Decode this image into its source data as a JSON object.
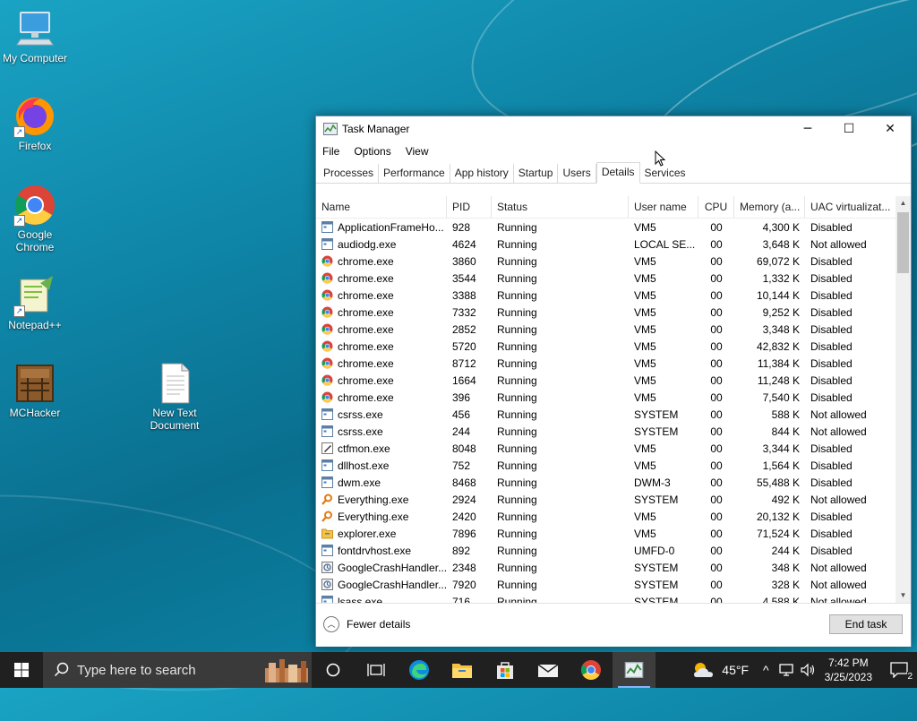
{
  "desktop": {
    "icons": [
      {
        "label": "My Computer"
      },
      {
        "label": "Firefox"
      },
      {
        "label": "Google Chrome"
      },
      {
        "label": "Notepad++"
      },
      {
        "label": "MCHacker"
      },
      {
        "label": "New Text Document"
      }
    ]
  },
  "window": {
    "title": "Task Manager",
    "controls": {
      "minimize": "─",
      "maximize": "☐",
      "close": "✕"
    },
    "menu": [
      "File",
      "Options",
      "View"
    ],
    "tabs": [
      "Processes",
      "Performance",
      "App history",
      "Startup",
      "Users",
      "Details",
      "Services"
    ],
    "active_tab": "Details",
    "columns": [
      "Name",
      "PID",
      "Status",
      "User name",
      "CPU",
      "Memory (a...",
      "UAC virtualizat..."
    ],
    "rows": [
      {
        "icon": "app-window-icon",
        "name": "ApplicationFrameHo...",
        "pid": "928",
        "status": "Running",
        "user": "VM5",
        "cpu": "00",
        "mem": "4,300 K",
        "uac": "Disabled"
      },
      {
        "icon": "app-window-icon",
        "name": "audiodg.exe",
        "pid": "4624",
        "status": "Running",
        "user": "LOCAL SE...",
        "cpu": "00",
        "mem": "3,648 K",
        "uac": "Not allowed"
      },
      {
        "icon": "chrome-icon",
        "name": "chrome.exe",
        "pid": "3860",
        "status": "Running",
        "user": "VM5",
        "cpu": "00",
        "mem": "69,072 K",
        "uac": "Disabled"
      },
      {
        "icon": "chrome-icon",
        "name": "chrome.exe",
        "pid": "3544",
        "status": "Running",
        "user": "VM5",
        "cpu": "00",
        "mem": "1,332 K",
        "uac": "Disabled"
      },
      {
        "icon": "chrome-icon",
        "name": "chrome.exe",
        "pid": "3388",
        "status": "Running",
        "user": "VM5",
        "cpu": "00",
        "mem": "10,144 K",
        "uac": "Disabled"
      },
      {
        "icon": "chrome-icon",
        "name": "chrome.exe",
        "pid": "7332",
        "status": "Running",
        "user": "VM5",
        "cpu": "00",
        "mem": "9,252 K",
        "uac": "Disabled"
      },
      {
        "icon": "chrome-icon",
        "name": "chrome.exe",
        "pid": "2852",
        "status": "Running",
        "user": "VM5",
        "cpu": "00",
        "mem": "3,348 K",
        "uac": "Disabled"
      },
      {
        "icon": "chrome-icon",
        "name": "chrome.exe",
        "pid": "5720",
        "status": "Running",
        "user": "VM5",
        "cpu": "00",
        "mem": "42,832 K",
        "uac": "Disabled"
      },
      {
        "icon": "chrome-icon",
        "name": "chrome.exe",
        "pid": "8712",
        "status": "Running",
        "user": "VM5",
        "cpu": "00",
        "mem": "11,384 K",
        "uac": "Disabled"
      },
      {
        "icon": "chrome-icon",
        "name": "chrome.exe",
        "pid": "1664",
        "status": "Running",
        "user": "VM5",
        "cpu": "00",
        "mem": "11,248 K",
        "uac": "Disabled"
      },
      {
        "icon": "chrome-icon",
        "name": "chrome.exe",
        "pid": "396",
        "status": "Running",
        "user": "VM5",
        "cpu": "00",
        "mem": "7,540 K",
        "uac": "Disabled"
      },
      {
        "icon": "app-window-icon",
        "name": "csrss.exe",
        "pid": "456",
        "status": "Running",
        "user": "SYSTEM",
        "cpu": "00",
        "mem": "588 K",
        "uac": "Not allowed"
      },
      {
        "icon": "app-window-icon",
        "name": "csrss.exe",
        "pid": "244",
        "status": "Running",
        "user": "SYSTEM",
        "cpu": "00",
        "mem": "844 K",
        "uac": "Not allowed"
      },
      {
        "icon": "pen-icon",
        "name": "ctfmon.exe",
        "pid": "8048",
        "status": "Running",
        "user": "VM5",
        "cpu": "00",
        "mem": "3,344 K",
        "uac": "Disabled"
      },
      {
        "icon": "app-window-icon",
        "name": "dllhost.exe",
        "pid": "752",
        "status": "Running",
        "user": "VM5",
        "cpu": "00",
        "mem": "1,564 K",
        "uac": "Disabled"
      },
      {
        "icon": "app-window-icon",
        "name": "dwm.exe",
        "pid": "8468",
        "status": "Running",
        "user": "DWM-3",
        "cpu": "00",
        "mem": "55,488 K",
        "uac": "Disabled"
      },
      {
        "icon": "magnifier-icon",
        "name": "Everything.exe",
        "pid": "2924",
        "status": "Running",
        "user": "SYSTEM",
        "cpu": "00",
        "mem": "492 K",
        "uac": "Not allowed"
      },
      {
        "icon": "magnifier-icon",
        "name": "Everything.exe",
        "pid": "2420",
        "status": "Running",
        "user": "VM5",
        "cpu": "00",
        "mem": "20,132 K",
        "uac": "Disabled"
      },
      {
        "icon": "folder-icon",
        "name": "explorer.exe",
        "pid": "7896",
        "status": "Running",
        "user": "VM5",
        "cpu": "00",
        "mem": "71,524 K",
        "uac": "Disabled"
      },
      {
        "icon": "app-window-icon",
        "name": "fontdrvhost.exe",
        "pid": "892",
        "status": "Running",
        "user": "UMFD-0",
        "cpu": "00",
        "mem": "244 K",
        "uac": "Disabled"
      },
      {
        "icon": "crash-handler-icon",
        "name": "GoogleCrashHandler...",
        "pid": "2348",
        "status": "Running",
        "user": "SYSTEM",
        "cpu": "00",
        "mem": "348 K",
        "uac": "Not allowed"
      },
      {
        "icon": "crash-handler-icon",
        "name": "GoogleCrashHandler...",
        "pid": "7920",
        "status": "Running",
        "user": "SYSTEM",
        "cpu": "00",
        "mem": "328 K",
        "uac": "Not allowed"
      },
      {
        "icon": "app-window-icon",
        "name": "lsass.exe",
        "pid": "716",
        "status": "Running",
        "user": "SYSTEM",
        "cpu": "00",
        "mem": "4,588 K",
        "uac": "Not allowed"
      }
    ],
    "footer": {
      "fewer_details": "Fewer details",
      "end_task": "End task"
    }
  },
  "taskbar": {
    "search_placeholder": "Type here to search",
    "weather": "45°F",
    "time": "7:42 PM",
    "date": "3/25/2023",
    "notification_count": "2"
  },
  "colors": {
    "accent": "#0078d7",
    "taskbar": "#202020"
  }
}
